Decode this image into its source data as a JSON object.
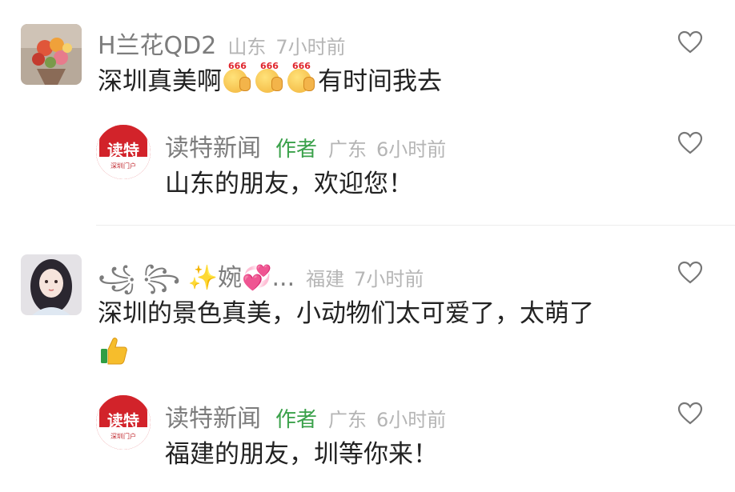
{
  "comments": [
    {
      "name": "H兰花QD2",
      "location": "山东",
      "time": "7小时前",
      "text_before": "深圳真美啊",
      "emoji_label": "666",
      "text_after": "有时间我去",
      "reply": {
        "name": "读特新闻",
        "author_tag": "作者",
        "location": "广东",
        "time": "6小时前",
        "text": "山东的朋友，欢迎您！",
        "avatar_text": "读特",
        "avatar_sub": "深圳门户"
      }
    },
    {
      "name": "꧁ ꧂ ✨婉💞...",
      "location": "福建",
      "time": "7小时前",
      "text": "深圳的景色真美，小动物们太可爱了，太萌了",
      "emoji": "thumbs-up-icon",
      "reply": {
        "name": "读特新闻",
        "author_tag": "作者",
        "location": "广东",
        "time": "6小时前",
        "text": "福建的朋友，圳等你来！",
        "avatar_text": "读特",
        "avatar_sub": "深圳门户"
      }
    }
  ],
  "colors": {
    "name": "#7c7c7c",
    "author_tag": "#3aa14a",
    "meta": "#b5b5b5",
    "text": "#222222",
    "brand_red": "#d2232a"
  }
}
